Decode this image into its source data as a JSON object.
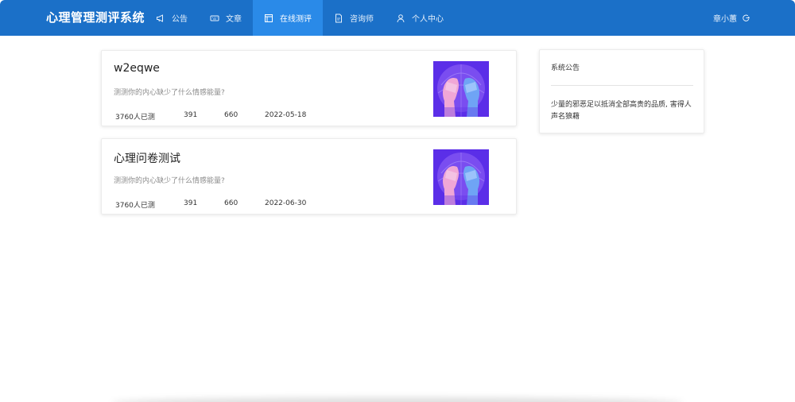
{
  "header": {
    "brand": "心理管理测评系统",
    "nav": [
      {
        "label": "公告",
        "icon": "megaphone-icon",
        "active": false
      },
      {
        "label": "文章",
        "icon": "keyboard-icon",
        "active": false
      },
      {
        "label": "在线测评",
        "icon": "window-icon",
        "active": true
      },
      {
        "label": "咨询师",
        "icon": "document-icon",
        "active": false
      },
      {
        "label": "个人中心",
        "icon": "user-icon",
        "active": false
      }
    ],
    "username": "章小蕙",
    "logout_icon": "logout-icon"
  },
  "tests": [
    {
      "title": "w2eqwe",
      "desc": "测测你的内心缺少了什么情感能量?",
      "tested": "3760人已测",
      "stat_a": "391",
      "stat_b": "660",
      "date": "2022-05-18"
    },
    {
      "title": "心理问卷测试",
      "desc": "测测你的内心缺少了什么情感能量?",
      "tested": "3760人已测",
      "stat_a": "391",
      "stat_b": "660",
      "date": "2022-06-30"
    }
  ],
  "notice": {
    "title": "系统公告",
    "body": "少量的邪恶足以抵消全部高贵的品质, 害得人声名狼藉"
  },
  "colors": {
    "header_bg": "#1b70c8",
    "nav_active_bg": "#2a8ae8"
  }
}
